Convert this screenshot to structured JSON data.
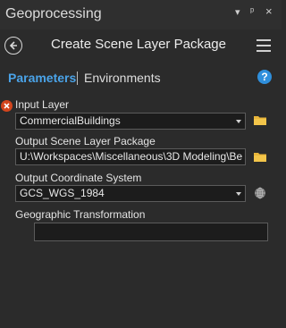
{
  "pane": {
    "title": "Geoprocessing",
    "controls": {
      "menu": "▾",
      "pin": "ᵖ",
      "close": "×"
    }
  },
  "header": {
    "tool_title": "Create Scene Layer Package"
  },
  "tabs": {
    "parameters": "Parameters",
    "environments": "Environments",
    "help": "?"
  },
  "params": {
    "input_layer": {
      "label": "Input Layer",
      "value": "CommercialBuildings"
    },
    "output_package": {
      "label": "Output Scene Layer Package",
      "value": "U:\\Workspaces\\Miscellaneous\\3D Modeling\\Be"
    },
    "output_cs": {
      "label": "Output Coordinate System",
      "value": "GCS_WGS_1984"
    },
    "geo_transform": {
      "label": "Geographic Transformation",
      "value": ""
    }
  },
  "colors": {
    "accent": "#4aa3e8",
    "error": "#d3451d",
    "folder": "#e8b53a",
    "background": "#2b2b2b"
  },
  "icons": [
    "back-arrow-icon",
    "hamburger-menu-icon",
    "help-icon",
    "error-icon",
    "dropdown-arrow-icon",
    "folder-icon",
    "globe-icon"
  ]
}
